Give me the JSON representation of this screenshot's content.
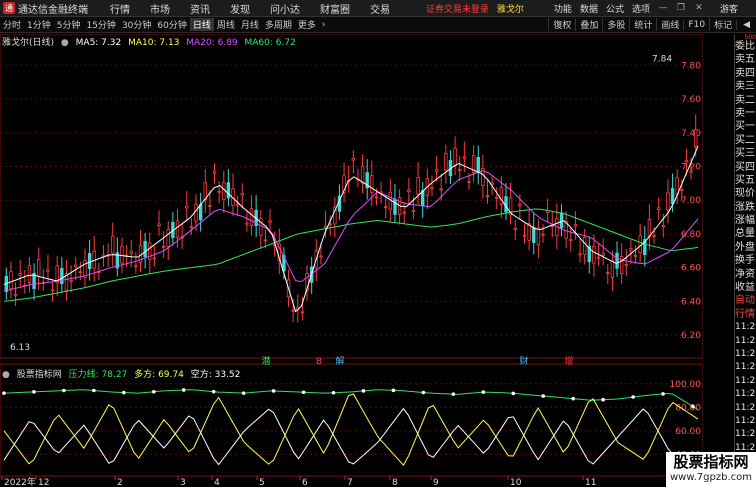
{
  "menubar": {
    "app_title": "通达信金融终端",
    "items": [
      "行情",
      "市场",
      "资讯",
      "发现",
      "问小达",
      "财富圈",
      "交易"
    ],
    "login_status": "证券交易未登录",
    "stock_name": "雅戈尔",
    "right_items": [
      "功能",
      "数据",
      "公式",
      "选项"
    ],
    "guest": "游客"
  },
  "periodbar": {
    "periods": [
      "分时",
      "1分钟",
      "5分钟",
      "15分钟",
      "30分钟",
      "60分钟",
      "日线",
      "周线",
      "月线",
      "多周期",
      "更多"
    ],
    "active_period": "日线",
    "tools": [
      "復权",
      "叠加",
      "多股",
      "统计",
      "画线",
      "F10",
      "标记"
    ]
  },
  "legend": {
    "stock_label": "雅戈尔(日线)",
    "ma": [
      {
        "label": "MA5: 7.32",
        "color": "#ffffff"
      },
      {
        "label": "MA10: 7.13",
        "color": "#ffff4a"
      },
      {
        "label": "MA20: 6.89",
        "color": "#e04bff"
      },
      {
        "label": "MA60: 6.72",
        "color": "#2ee65a"
      }
    ]
  },
  "indicator_legend": {
    "name": "股票指标网",
    "items": [
      {
        "label": "压力线: 78.27",
        "color": "#2ee65a"
      },
      {
        "label": "多方: 69.74",
        "color": "#ffff4a"
      },
      {
        "label": "空方: 33.52",
        "color": "#ffffff"
      }
    ]
  },
  "chart_data": {
    "type": "line",
    "price_ticks": [
      "7.80",
      "7.60",
      "7.40",
      "7.20",
      "7.00",
      "6.80",
      "6.60",
      "6.40",
      "6.20"
    ],
    "price_ylim": [
      6.1,
      7.95
    ],
    "indicator_ticks": [
      "100.00",
      "80.00",
      "60.00",
      "40.00"
    ],
    "indicator_ylim": [
      25,
      110
    ],
    "high_label": "7.84",
    "low_label": "6.13",
    "x_labels": [
      "2022年",
      "12",
      "2",
      "3",
      "4",
      "5",
      "6",
      "7",
      "8",
      "9",
      "10",
      "11"
    ],
    "event_marks": [
      {
        "label": "潜",
        "color": "#2ee65a"
      },
      {
        "label": "B",
        "color": "#ff3b3b"
      },
      {
        "label": "解",
        "color": "#4ab0ff"
      },
      {
        "label": "财",
        "color": "#4ab0ff"
      },
      {
        "label": "增",
        "color": "#ff3b3b"
      }
    ],
    "price_series": [
      {
        "name": "MA60",
        "color": "#2ee65a",
        "values": [
          6.4,
          6.42,
          6.45,
          6.48,
          6.52,
          6.55,
          6.58,
          6.6,
          6.62,
          6.68,
          6.74,
          6.8,
          6.83,
          6.86,
          6.88,
          6.86,
          6.84,
          6.86,
          6.9,
          6.93,
          6.95,
          6.92,
          6.86,
          6.8,
          6.74,
          6.7,
          6.72
        ]
      },
      {
        "name": "MA20",
        "color": "#e04bff",
        "values": [
          6.46,
          6.5,
          6.52,
          6.55,
          6.6,
          6.64,
          6.7,
          6.82,
          6.95,
          6.9,
          6.82,
          6.5,
          6.62,
          6.9,
          7.05,
          6.98,
          6.96,
          7.12,
          7.18,
          7.06,
          6.9,
          6.82,
          6.78,
          6.65,
          6.62,
          6.7,
          6.89
        ]
      },
      {
        "name": "MA5",
        "color": "#ffffff",
        "values": [
          6.5,
          6.56,
          6.52,
          6.62,
          6.68,
          6.66,
          6.78,
          6.9,
          7.1,
          6.95,
          6.82,
          6.3,
          6.8,
          7.15,
          7.05,
          6.95,
          7.1,
          7.22,
          7.15,
          6.92,
          6.82,
          6.88,
          6.7,
          6.62,
          6.75,
          6.95,
          7.32
        ]
      }
    ],
    "indicator_series": [
      {
        "name": "压力线",
        "color": "#2ee65a",
        "values": [
          92,
          93,
          94,
          95,
          93,
          92,
          94,
          95,
          93,
          92,
          94,
          93,
          92,
          93,
          95,
          94,
          92,
          91,
          93,
          92,
          90,
          88,
          86,
          87,
          90,
          92,
          78
        ]
      },
      {
        "name": "多方",
        "color": "#ffff4a",
        "values": [
          60,
          30,
          75,
          45,
          85,
          35,
          70,
          40,
          90,
          50,
          30,
          80,
          40,
          95,
          55,
          30,
          85,
          45,
          70,
          35,
          80,
          40,
          90,
          50,
          35,
          85,
          70
        ]
      },
      {
        "name": "空方",
        "color": "#ffffff",
        "values": [
          35,
          70,
          40,
          65,
          30,
          70,
          45,
          75,
          30,
          60,
          80,
          35,
          70,
          30,
          50,
          80,
          35,
          65,
          40,
          75,
          35,
          70,
          30,
          55,
          80,
          40,
          34
        ]
      }
    ]
  },
  "right_panel": {
    "top_mark": "500",
    "items": [
      "委比",
      "卖五",
      "卖四",
      "卖三",
      "卖二",
      "卖一",
      "买一",
      "买二",
      "买三",
      "买四",
      "买五",
      "现价",
      "涨跌",
      "涨幅",
      "总量",
      "外盘",
      "换手",
      "净资",
      "收益",
      "自动",
      "行情"
    ],
    "times": [
      "11:29",
      "11:29",
      "11:29",
      "11:29",
      "11:29",
      "11:29",
      "11:29",
      "11:29",
      "11:29",
      "11:29",
      "11:29",
      "11:29"
    ]
  },
  "watermark": {
    "title": "股票指标网",
    "url": "www.7gpzb.com"
  }
}
